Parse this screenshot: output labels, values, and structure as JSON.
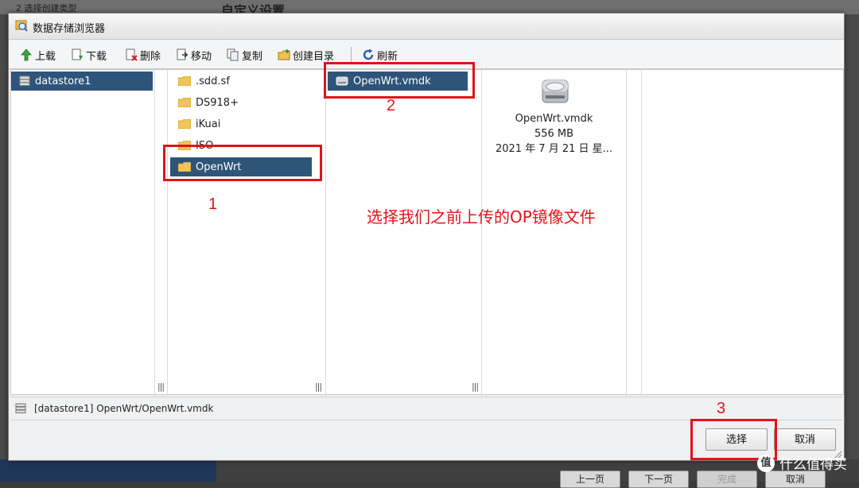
{
  "background": {
    "heading": "自定义设置",
    "left_heading": "2 选择创建类型",
    "buttons": [
      "上一页",
      "下一页",
      "完成",
      "取消"
    ]
  },
  "dialog": {
    "title": "数据存储浏览器",
    "toolbar": {
      "upload": "上载",
      "download": "下载",
      "delete": "删除",
      "move": "移动",
      "copy": "复制",
      "mkdir": "创建目录",
      "refresh": "刷新"
    },
    "datastores": [
      {
        "label": "datastore1",
        "selected": true
      }
    ],
    "folders": [
      {
        "label": ".sdd.sf",
        "selected": false
      },
      {
        "label": "DS918+",
        "selected": false
      },
      {
        "label": "iKuai",
        "selected": false
      },
      {
        "label": "ISO",
        "selected": false
      },
      {
        "label": "OpenWrt",
        "selected": true
      }
    ],
    "files": [
      {
        "label": "OpenWrt.vmdk",
        "selected": true
      }
    ],
    "preview": {
      "name": "OpenWrt.vmdk",
      "size": "556 MB",
      "date": "2021 年 7 月 21 日 星..."
    },
    "status_path": "[datastore1] OpenWrt/OpenWrt.vmdk",
    "select_button": "选择",
    "cancel_button": "取消"
  },
  "annotations": {
    "num1": "1",
    "num2": "2",
    "num3": "3",
    "note": "选择我们之前上传的OP镜像文件",
    "color": "#e0131b"
  },
  "watermark": {
    "logo_text": "值",
    "text": "什么值得买"
  },
  "colors": {
    "selection": "#2f5479",
    "annotation": "#e0131b"
  }
}
